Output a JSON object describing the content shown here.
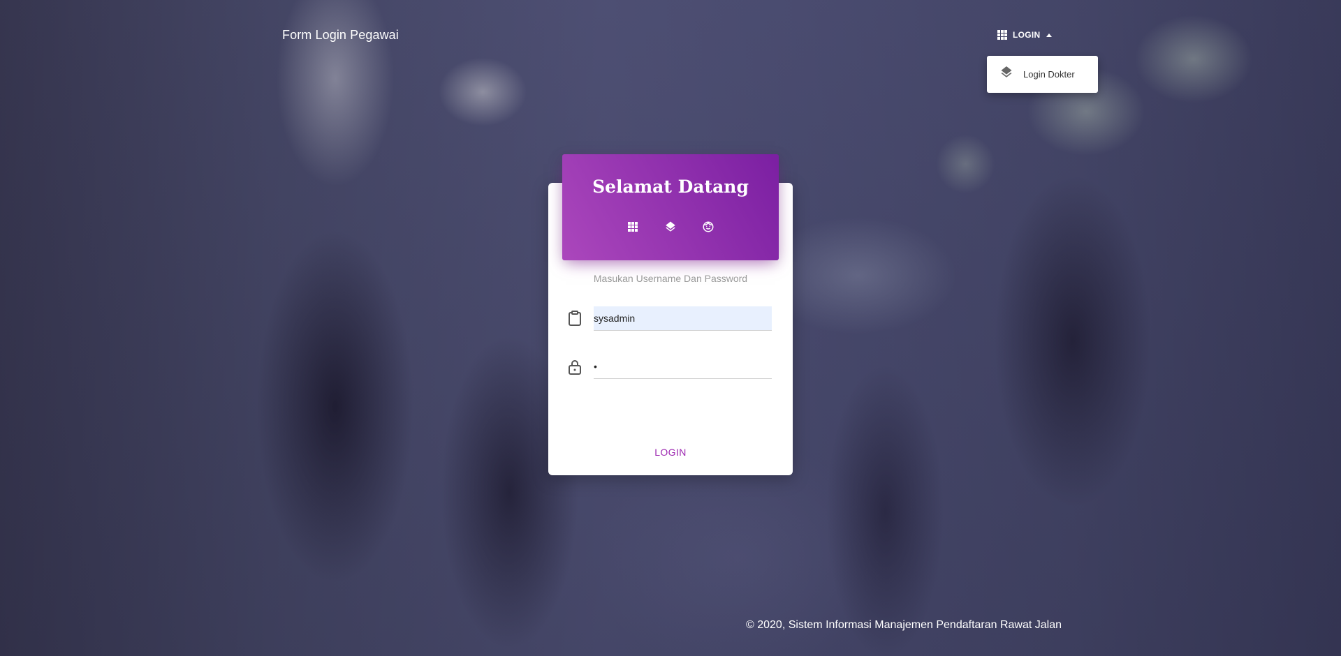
{
  "navbar": {
    "brand": "Form Login Pegawai",
    "login_menu_label": "LOGIN",
    "dropdown": {
      "items": [
        {
          "label": "Login Dokter",
          "icon": "layers-icon"
        }
      ]
    }
  },
  "card": {
    "title": "Selamat Datang",
    "social_icons": [
      "apps-icon",
      "layers-icon",
      "face-icon"
    ],
    "subtitle": "Masukan Username Dan Password",
    "username": {
      "value": "sysadmin",
      "icon": "clipboard-icon"
    },
    "password": {
      "value": "•",
      "icon": "lock-icon"
    },
    "login_button": "LOGIN"
  },
  "footer": {
    "text": "© 2020, Sistem Informasi Manajemen Pendaftaran Rawat Jalan"
  },
  "colors": {
    "accent": "#9c27b0",
    "header_gradient_start": "#ab47bc",
    "header_gradient_end": "#7b1fa2",
    "input_autofill": "#e8f0fe"
  }
}
